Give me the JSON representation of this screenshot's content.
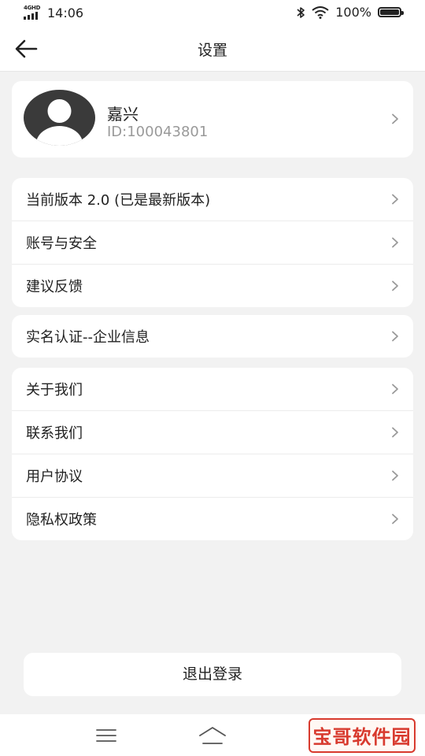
{
  "status_bar": {
    "network": "4GHD",
    "time": "14:06",
    "battery_text": "100%",
    "battery_level": 1.0
  },
  "header": {
    "title": "设置"
  },
  "profile": {
    "name": "嘉兴",
    "id": "ID:100043801"
  },
  "groups": [
    {
      "items": [
        "当前版本 2.0 (已是最新版本)",
        "账号与安全",
        "建议反馈"
      ]
    },
    {
      "items": [
        "实名认证--企业信息"
      ]
    },
    {
      "items": [
        "关于我们",
        "联系我们",
        "用户协议",
        "隐私权政策"
      ]
    }
  ],
  "logout_label": "退出登录",
  "watermark_text": "宝哥软件园"
}
